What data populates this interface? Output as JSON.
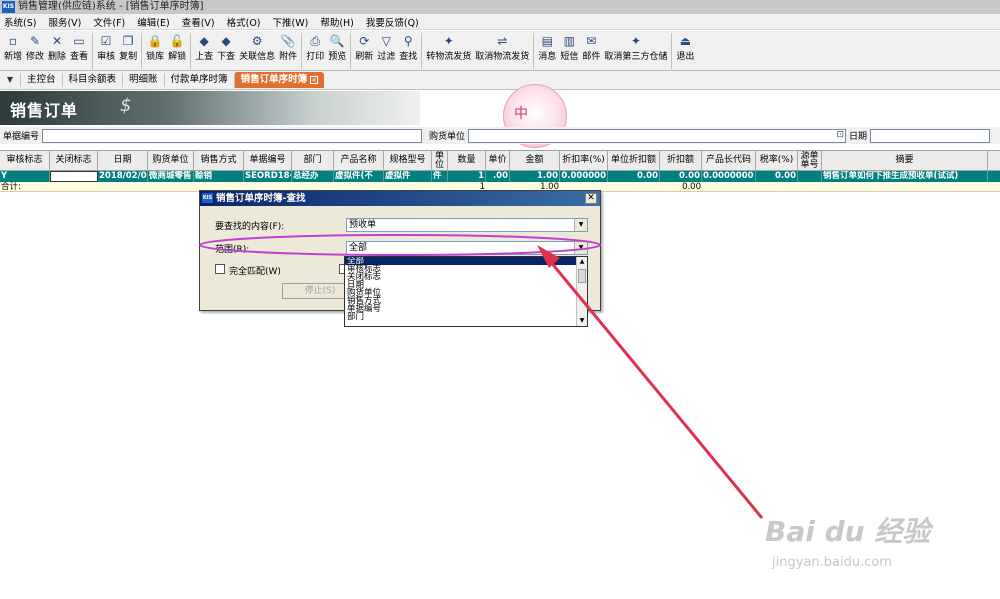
{
  "window": {
    "title": "销售管理(供应链)系统 - [销售订单序时簿]",
    "app_icon": "KIS"
  },
  "menu": [
    "系统(S)",
    "服务(V)",
    "文件(F)",
    "编辑(E)",
    "查看(V)",
    "格式(O)",
    "下推(W)",
    "帮助(H)",
    "我要反馈(Q)"
  ],
  "toolbar": [
    {
      "label": "新增",
      "icon": "new-icon",
      "glyph": "▫"
    },
    {
      "label": "修改",
      "icon": "edit-icon",
      "glyph": "✎"
    },
    {
      "label": "删除",
      "icon": "delete-icon",
      "glyph": "✕"
    },
    {
      "label": "查看",
      "icon": "view-icon",
      "glyph": "▭"
    },
    {
      "label": "审核",
      "icon": "audit-icon",
      "glyph": "☑"
    },
    {
      "label": "复制",
      "icon": "copy-icon",
      "glyph": "❐"
    },
    {
      "label": "锁库",
      "icon": "lock-icon",
      "glyph": "🔒"
    },
    {
      "label": "解锁",
      "icon": "unlock-icon",
      "glyph": "🔓"
    },
    {
      "label": "上查",
      "icon": "up-query-icon",
      "glyph": "◆"
    },
    {
      "label": "下查",
      "icon": "down-query-icon",
      "glyph": "◆"
    },
    {
      "label": "关联信息",
      "icon": "related-info-icon",
      "glyph": "⚙"
    },
    {
      "label": "附件",
      "icon": "attachment-icon",
      "glyph": "📎"
    },
    {
      "label": "打印",
      "icon": "print-icon",
      "glyph": "⎙"
    },
    {
      "label": "预览",
      "icon": "preview-icon",
      "glyph": "🔍"
    },
    {
      "label": "刷新",
      "icon": "refresh-icon",
      "glyph": "⟳"
    },
    {
      "label": "过滤",
      "icon": "filter-icon",
      "glyph": "▽"
    },
    {
      "label": "查找",
      "icon": "find-icon",
      "glyph": "⚲"
    },
    {
      "label": "转物流发货",
      "icon": "logistics-icon",
      "glyph": "✦"
    },
    {
      "label": "取消物流发货",
      "icon": "cancel-logistics-icon",
      "glyph": "⇌"
    },
    {
      "label": "消息",
      "icon": "message-icon",
      "glyph": "▤"
    },
    {
      "label": "短信",
      "icon": "sms-icon",
      "glyph": "▥"
    },
    {
      "label": "邮件",
      "icon": "mail-icon",
      "glyph": "✉"
    },
    {
      "label": "取消第三方仓储",
      "icon": "cancel-warehouse-icon",
      "glyph": "✦"
    },
    {
      "label": "退出",
      "icon": "exit-icon",
      "glyph": "⏏"
    }
  ],
  "nav_tabs": [
    "主控台",
    "科目余额表",
    "明细账",
    "付款单序时簿",
    "销售订单序时簿"
  ],
  "banner": {
    "title": "销售订单",
    "symbol": "$"
  },
  "seal_char": "中",
  "search": {
    "doc_no_label": "单据编号",
    "buyer_label": "购货单位",
    "date_label": "日期"
  },
  "grid": {
    "headers": [
      "审核标志",
      "关闭标志",
      "日期",
      "购货单位",
      "销售方式",
      "单据编号",
      "部门",
      "产品名称",
      "规格型号",
      "单位",
      "数量",
      "单价",
      "金额",
      "折扣率(%)",
      "单位折扣额",
      "折扣额",
      "产品长代码",
      "税率(%)",
      "源单单号",
      "摘要"
    ],
    "row": [
      "Y",
      "",
      "2018/02/0",
      "微商城零售",
      "赊销",
      "SEORD18-0",
      "总经办",
      "虚拟件(不",
      "虚拟件",
      "件",
      "1",
      ".00",
      "1.00",
      "0.000000",
      "0.00",
      "0.00",
      "0.0000000",
      "0.00",
      "",
      "销售订单如何下推生成预收单(试试)"
    ],
    "sum": [
      "合计:",
      "",
      "",
      "",
      "",
      "",
      "",
      "",
      "",
      "",
      "1",
      "",
      "1.00",
      "",
      "",
      "0.00",
      "",
      "",
      "",
      ""
    ]
  },
  "dialog": {
    "title": "销售订单序时簿-查找",
    "find_label": "要查找的内容(F):",
    "find_value": "预收单",
    "range_label": "范围(R):",
    "range_value": "全部",
    "exact_label": "完全匹配(W)",
    "stop_button": "停止(S)",
    "options": [
      "全部",
      "审核标志",
      "关闭标志",
      "日期",
      "购货单位",
      "销售方式",
      "单据编号",
      "部门"
    ]
  },
  "watermark": {
    "brand": "Bai du 经验",
    "url": "jingyan.baidu.com"
  },
  "colors": {
    "selected_row": "#008080",
    "active_tab": "#e07030",
    "annotation": "#e03050",
    "highlight": "#c040d0"
  }
}
